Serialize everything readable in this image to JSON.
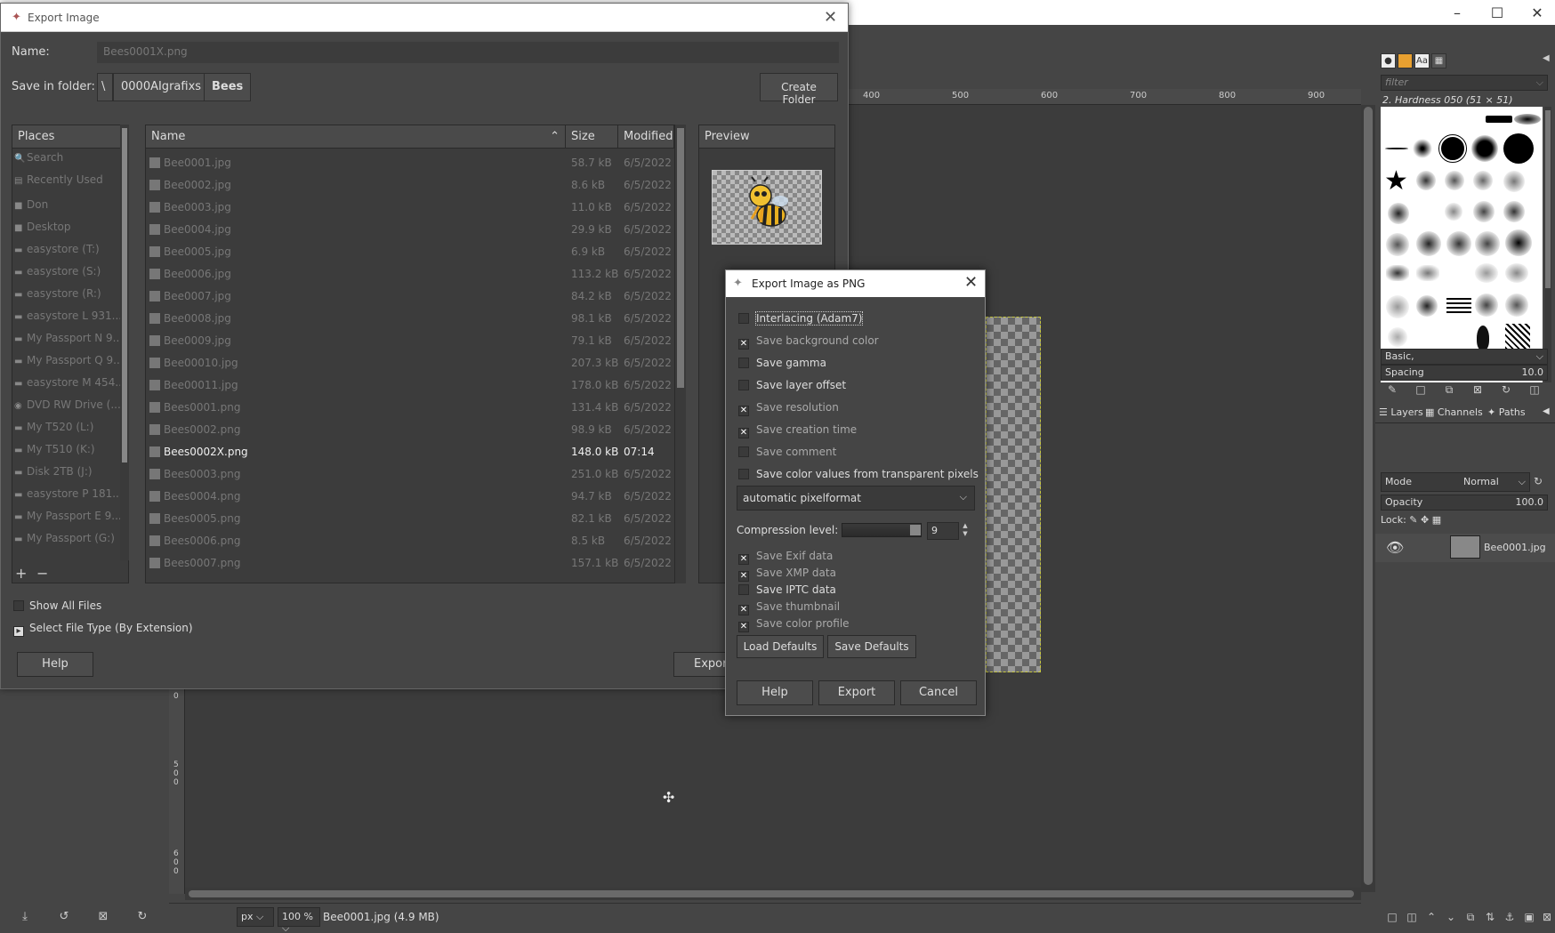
{
  "gimp": {
    "ruler_ticks": [
      "400",
      "500",
      "600",
      "700",
      "800",
      "900"
    ],
    "vruler_labels": [
      "0",
      "5",
      "0",
      "0",
      "6",
      "0",
      "0"
    ],
    "statusbar": {
      "unit": "px",
      "zoom": "100 %",
      "file_info": "Bee0001.jpg (4.9 MB)"
    }
  },
  "right_dock": {
    "filter_placeholder": "filter",
    "brush_name": "2. Hardness 050 (51 × 51)",
    "brush_set": "Basic,",
    "spacing_label": "Spacing",
    "spacing_value": "10.0",
    "tabs": {
      "layers": "Layers",
      "channels": "Channels",
      "paths": "Paths"
    },
    "mode_label": "Mode",
    "mode_value": "Normal",
    "opacity_label": "Opacity",
    "opacity_value": "100.0",
    "lock_label": "Lock:",
    "layer_name": "Bee0001.jpg"
  },
  "export_dialog": {
    "title": "Export Image",
    "name_label": "Name:",
    "name_value": "Bees0001X.png",
    "folder_label": "Save in folder:",
    "crumbs": [
      "\\",
      "0000AIgrafixs",
      "Bees"
    ],
    "create_folder": "Create Folder",
    "places_header": "Places",
    "places": [
      {
        "icon": "search-icon",
        "label": "Search"
      },
      {
        "icon": "recent-icon",
        "label": "Recently Used"
      },
      {
        "icon": "folder-icon",
        "label": "Don"
      },
      {
        "icon": "folder-icon",
        "label": "Desktop"
      },
      {
        "icon": "drive-icon",
        "label": "easystore (T:)"
      },
      {
        "icon": "drive-icon",
        "label": "easystore (S:)"
      },
      {
        "icon": "drive-icon",
        "label": "easystore (R:)"
      },
      {
        "icon": "drive-icon",
        "label": "easystore L 931..."
      },
      {
        "icon": "drive-icon",
        "label": "My Passport N 9..."
      },
      {
        "icon": "drive-icon",
        "label": "My Passport Q 9..."
      },
      {
        "icon": "drive-icon",
        "label": "easystore M 454..."
      },
      {
        "icon": "disc-icon",
        "label": "DVD RW Drive (..."
      },
      {
        "icon": "drive-icon",
        "label": "My T520 (L:)"
      },
      {
        "icon": "drive-icon",
        "label": "My T510 (K:)"
      },
      {
        "icon": "drive-icon",
        "label": "Disk 2TB (J:)"
      },
      {
        "icon": "drive-icon",
        "label": "easystore P 181..."
      },
      {
        "icon": "drive-icon",
        "label": "My Passport E 9..."
      },
      {
        "icon": "drive-icon",
        "label": "My Passport (G:)"
      }
    ],
    "columns": {
      "name": "Name",
      "size": "Size",
      "modified": "Modified"
    },
    "files": [
      {
        "name": "Bee0001.jpg",
        "size": "58.7 kB",
        "modified": "6/5/2022"
      },
      {
        "name": "Bee0002.jpg",
        "size": "8.6 kB",
        "modified": "6/5/2022"
      },
      {
        "name": "Bee0003.jpg",
        "size": "11.0 kB",
        "modified": "6/5/2022"
      },
      {
        "name": "Bee0004.jpg",
        "size": "29.9 kB",
        "modified": "6/5/2022"
      },
      {
        "name": "Bee0005.jpg",
        "size": "6.9 kB",
        "modified": "6/5/2022"
      },
      {
        "name": "Bee0006.jpg",
        "size": "113.2 kB",
        "modified": "6/5/2022"
      },
      {
        "name": "Bee0007.jpg",
        "size": "84.2 kB",
        "modified": "6/5/2022"
      },
      {
        "name": "Bee0008.jpg",
        "size": "98.1 kB",
        "modified": "6/5/2022"
      },
      {
        "name": "Bee0009.jpg",
        "size": "79.1 kB",
        "modified": "6/5/2022"
      },
      {
        "name": "Bee00010.jpg",
        "size": "207.3 kB",
        "modified": "6/5/2022"
      },
      {
        "name": "Bee00011.jpg",
        "size": "178.0 kB",
        "modified": "6/5/2022"
      },
      {
        "name": "Bees0001.png",
        "size": "131.4 kB",
        "modified": "6/5/2022"
      },
      {
        "name": "Bees0002.png",
        "size": "98.9 kB",
        "modified": "6/5/2022"
      },
      {
        "name": "Bees0002X.png",
        "size": "148.0 kB",
        "modified": "07:14"
      },
      {
        "name": "Bees0003.png",
        "size": "251.0 kB",
        "modified": "6/5/2022"
      },
      {
        "name": "Bees0004.png",
        "size": "94.7 kB",
        "modified": "6/5/2022"
      },
      {
        "name": "Bees0005.png",
        "size": "82.1 kB",
        "modified": "6/5/2022"
      },
      {
        "name": "Bees0006.png",
        "size": "8.5 kB",
        "modified": "6/5/2022"
      },
      {
        "name": "Bees0007.png",
        "size": "157.1 kB",
        "modified": "6/5/2022"
      }
    ],
    "selected_file_index": 13,
    "preview_header": "Preview",
    "show_all_files": "Show All Files",
    "select_file_type": "Select File Type (By Extension)",
    "help": "Help",
    "export": "Export"
  },
  "png_dialog": {
    "title": "Export Image as PNG",
    "options": [
      {
        "label": "Interlacing (Adam7)",
        "checked": false
      },
      {
        "label": "Save background color",
        "checked": true
      },
      {
        "label": "Save gamma",
        "checked": false
      },
      {
        "label": "Save layer offset",
        "checked": false
      },
      {
        "label": "Save resolution",
        "checked": true
      },
      {
        "label": "Save creation time",
        "checked": true
      },
      {
        "label": "Save comment",
        "checked": false
      },
      {
        "label": "Save color values from transparent pixels",
        "checked": false
      }
    ],
    "pixelformat": "automatic pixelformat",
    "compression_label": "Compression level:",
    "compression_value": "9",
    "metadata": [
      {
        "label": "Save Exif data",
        "checked": true
      },
      {
        "label": "Save XMP data",
        "checked": true
      },
      {
        "label": "Save IPTC data",
        "checked": false
      },
      {
        "label": "Save thumbnail",
        "checked": true
      },
      {
        "label": "Save color profile",
        "checked": true
      }
    ],
    "load_defaults": "Load Defaults",
    "save_defaults": "Save Defaults",
    "help": "Help",
    "export": "Export",
    "cancel": "Cancel"
  }
}
